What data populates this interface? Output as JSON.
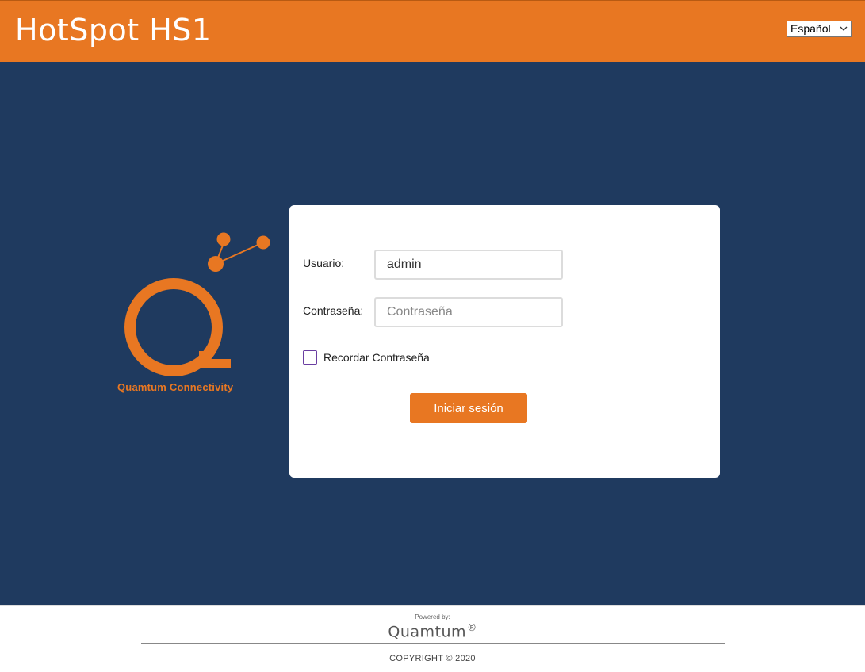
{
  "header": {
    "title": "HotSpot HS1",
    "language_selected": "Español",
    "background_color": "#e87722"
  },
  "brand": {
    "logo_icon": "quamtum-q-logo-icon",
    "name": "Quamtum Connectivity",
    "accent_color": "#e87722"
  },
  "login": {
    "username_label": "Usuario:",
    "username_value": "admin",
    "password_label": "Contraseña:",
    "password_placeholder": "Contraseña",
    "password_value": "",
    "remember_label": "Recordar Contraseña",
    "remember_checked": false,
    "submit_label": "Iniciar sesión"
  },
  "footer": {
    "powered_by": "Powered by:",
    "brand": "Quamtum",
    "registered_mark": "®",
    "copyright": "COPYRIGHT © 2020"
  },
  "colors": {
    "main_background": "#1f3a5f",
    "card_background": "#ffffff"
  }
}
